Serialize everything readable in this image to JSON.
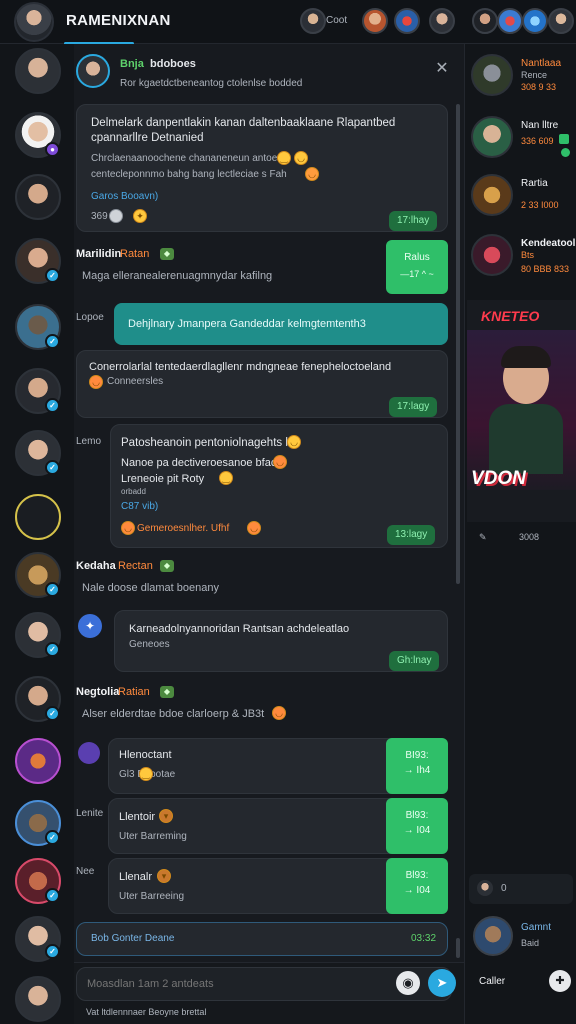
{
  "app": {
    "title": "RAMENIXNAN",
    "header_label": "Coot"
  },
  "colors": {
    "accent": "#2aa9e0",
    "green": "#2fbf69",
    "orange": "#ff8a3d",
    "teal": "#1f8e8a"
  },
  "pinned": {
    "name": "Bnja",
    "role": "bdoboes",
    "text": "Ror kgaetdctbeneantog ctolenlse bodded"
  },
  "messages": {
    "m1": {
      "line1": "Delmelark danpentlakin kanan daltenbaaklaane Rlapantbed",
      "line2": "cpannarllre Detnanied",
      "line3": "Chrclaenaanoochene chananeneun antoe",
      "line4": "centecleponnmo bahg bang lectleciae s Fah",
      "link": "Garos Booavn)",
      "count": "369",
      "time": "17:lhay"
    },
    "m2": {
      "name": "Marilidin",
      "role": "Ratan",
      "text": "Maga elleranealerenuagmnydar kafilng",
      "green1": "Ralus",
      "green2": "—17 ^ ~"
    },
    "m3": {
      "label": "Lopoe",
      "text": "Dehjlnary Jmanpera Gandeddar kelmgtemtenth3"
    },
    "m4": {
      "line1": "Conerrolarlal tentedaerdlagllenr mdngneae fenepheloctoeland",
      "line2": "Conneersles",
      "time": "17:lagy"
    },
    "m5": {
      "label": "Lemo",
      "line1": "Patosheanoin pentoniolnagehts h3",
      "line2": "Nanoe pa dectiveroesanoe bfac",
      "line3": "Lreneoie pit Roty",
      "line4": "orbadd",
      "link": "C87 vib)",
      "foot": "Gemeroesnlher. Ufhf",
      "time": "13:lagy"
    },
    "m6": {
      "name": "Kedaha",
      "role": "Rectan",
      "text": "Nale doose dlamat boenany"
    },
    "m7": {
      "line1": "Karneadolnyannoridan Rantsan achdeleatlao",
      "line2": "Geneoes",
      "time": "Gh:lnay"
    },
    "m8": {
      "name": "Negtolia",
      "role": "Ratian",
      "text": "Alser elderdtae bdoe clarloerp & JB3t"
    },
    "m9": {
      "title": "Hlenoctant",
      "sub": "Gl3 Deootae",
      "g1": "BI93:",
      "g2": "→ Ih4"
    },
    "m10": {
      "label": "Lenite",
      "title": "Llentoir",
      "sub": "Uter Barreming",
      "g1": "Bl93:",
      "g2": "→ I04"
    },
    "m11": {
      "label": "Nee",
      "title": "Llenalr",
      "sub": "Uter Barreeing",
      "g1": "Bl93:",
      "g2": "→ I04"
    },
    "m12": {
      "text": "Bob Gonter Deane",
      "time": "03:32"
    }
  },
  "input": {
    "placeholder": "Moasdlan 1am 2 antdeats",
    "foot": "Vat ltdlennnaer Beoyne brettal"
  },
  "right": {
    "items": [
      {
        "name": "Nantlaaa",
        "sub": "Rence",
        "sub2": "308 9 33"
      },
      {
        "name": "Nan lltre",
        "sub": "336 609"
      },
      {
        "name": "Rartia",
        "sub": "2 33 I000"
      },
      {
        "name": "Kendeatool",
        "sub": "Bts",
        "sub2": "80 BBB 833"
      }
    ],
    "promo_title": "KNETEO",
    "promo_big": "VDON",
    "promo_count": "3008",
    "mini_count": "0",
    "dm_name": "Gamnt",
    "dm_sub": "Baid",
    "foot": "Caller"
  }
}
